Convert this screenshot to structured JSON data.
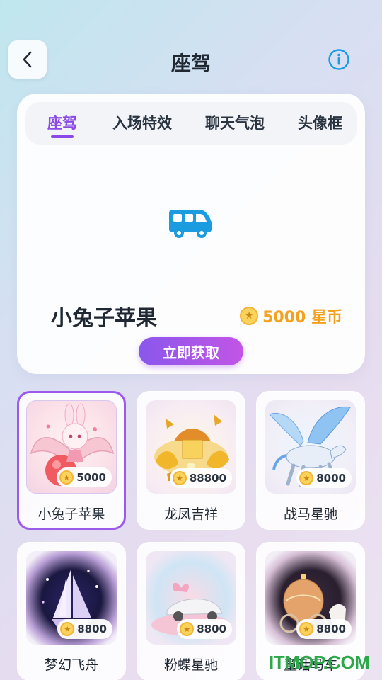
{
  "header": {
    "title": "座驾",
    "back_icon": "chevron-left-icon",
    "info_icon": "info-icon"
  },
  "tabs": [
    {
      "label": "座驾",
      "active": true
    },
    {
      "label": "入场特效",
      "active": false
    },
    {
      "label": "聊天气泡",
      "active": false
    },
    {
      "label": "头像框",
      "active": false
    }
  ],
  "preview": {
    "icon": "bus-icon",
    "item_name": "小兔子苹果",
    "price": "5000 星币",
    "action_label": "立即获取"
  },
  "items": [
    {
      "name": "小兔子苹果",
      "price": "5000",
      "selected": true
    },
    {
      "name": "龙凤吉祥",
      "price": "88800",
      "selected": false
    },
    {
      "name": "战马星驰",
      "price": "8000",
      "selected": false
    },
    {
      "name": "梦幻飞舟",
      "price": "8800",
      "selected": false
    },
    {
      "name": "粉蝶星驰",
      "price": "8800",
      "selected": false
    },
    {
      "name": "童话马车",
      "price": "8800",
      "selected": false
    }
  ],
  "coin_glyph": "★",
  "watermark": "ITMOP.COM",
  "colors": {
    "accent": "#8b4ae6",
    "price": "#f4a11d",
    "info": "#1b9be0",
    "watermark": "#2ca84a"
  }
}
